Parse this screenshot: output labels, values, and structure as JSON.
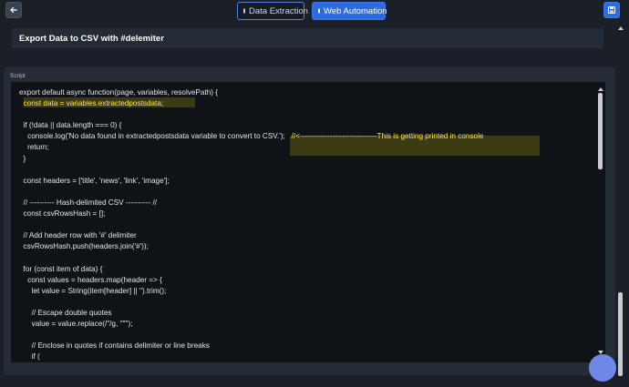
{
  "header": {
    "back_icon": "arrow-left-icon",
    "save_icon": "save-icon",
    "modes": [
      {
        "label": "Data Extraction",
        "active": false
      },
      {
        "label": "Web Automation",
        "active": true
      }
    ]
  },
  "section": {
    "title": "Export Data to CSV with #delemiter"
  },
  "script": {
    "label": "Script",
    "lines": [
      "export default async function(page, variables, resolvePath) {",
      "  const data = variables.extractedpostsdata;",
      "",
      "  if (!data || data.length === 0) {",
      "    console.log('No data found in extractedpostsdata variable to convert to CSV.');   //<-------------------------------This is getting printed in console",
      "    return;",
      "  }",
      "",
      "  const headers = ['title', 'news', 'link', 'image'];",
      "",
      "  // ---------- Hash-delimited CSV ---------- //",
      "  const csvRowsHash = [];",
      "",
      "  // Add header row with '#' delimiter",
      "  csvRowsHash.push(headers.join('#'));",
      "",
      "  for (const item of data) {",
      "    const values = headers.map(header => {",
      "      let value = String(item[header] || '').trim();",
      "",
      "      // Escape double quotes",
      "      value = value.replace(/\"/g, '\"\"');",
      "",
      "      // Enclose in quotes if contains delimiter or line breaks",
      "      if ("
    ]
  },
  "colors": {
    "accent": "#2f6be0",
    "highlight_text": "#ffea4a",
    "highlight_bg": "#3b3a12"
  }
}
